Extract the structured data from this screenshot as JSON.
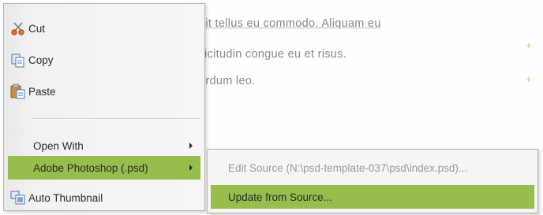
{
  "document": {
    "lines": [
      "pit tellus eu commodo. Aliquam eu",
      "llicitudin congue eu et risus.",
      "erdum leo."
    ],
    "marks": [
      "+",
      "+"
    ]
  },
  "context_menu": {
    "items": [
      {
        "label": "Cut",
        "icon": "scissors-icon"
      },
      {
        "label": "Copy",
        "icon": "copy-icon"
      },
      {
        "label": "Paste",
        "icon": "paste-icon"
      },
      {
        "label": "Open With",
        "submenu": true
      },
      {
        "label": "Adobe Photoshop (.psd)",
        "submenu": true,
        "highlighted": true
      },
      {
        "label": "Auto Thumbnail",
        "icon": "thumbnail-icon"
      }
    ]
  },
  "submenu": {
    "items": [
      {
        "label": "Edit Source (N:\\psd-template-037\\psd\\index.psd)...",
        "disabled": true
      },
      {
        "label": "Update from Source...",
        "highlighted": true
      }
    ]
  },
  "colors": {
    "highlight": "#97bd4c",
    "menu_bg": "#f6f6f6",
    "disabled_text": "#9a9a9a",
    "document_text": "#8a8a8a"
  }
}
